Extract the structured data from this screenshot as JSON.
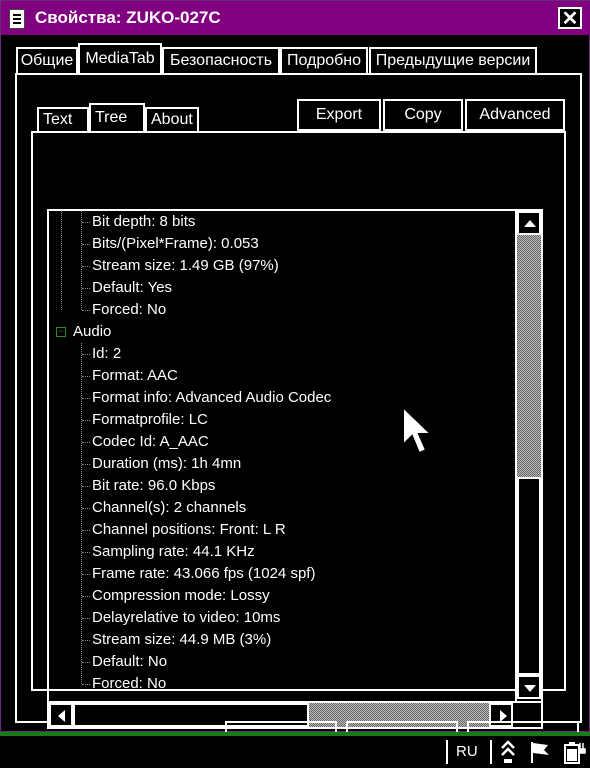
{
  "window": {
    "title": "Свойства: ZUKO-027C",
    "close_label": "✕"
  },
  "main_tabs": [
    {
      "label": "Общие",
      "active": false
    },
    {
      "label": "MediaTab",
      "active": true
    },
    {
      "label": "Безопасность",
      "active": false
    },
    {
      "label": "Подробно",
      "active": false
    },
    {
      "label": "Предыдущие версии",
      "active": false
    }
  ],
  "sub_tabs": [
    {
      "label": "Text",
      "active": false
    },
    {
      "label": "Tree",
      "active": true
    },
    {
      "label": "About",
      "active": false
    }
  ],
  "actions": {
    "export_label": "Export",
    "copy_label": "Copy",
    "advanced_label": "Advanced"
  },
  "tree": {
    "video_items": [
      "Bit depth: 8 bits",
      "Bits/(Pixel*Frame): 0.053",
      "Stream size: 1.49 GB (97%)",
      "Default: Yes",
      "Forced: No"
    ],
    "audio_node": {
      "label": "Audio",
      "toggle": "−",
      "items": [
        "Id: 2",
        "Format: AAC",
        "Format info: Advanced Audio Codec",
        "Formatprofile: LC",
        "Codec Id: A_AAC",
        "Duration (ms): 1h 4mn",
        "Bit rate: 96.0 Kbps",
        "Channel(s): 2 channels",
        "Channel positions: Front: L R",
        "Sampling rate: 44.1 KHz",
        "Frame rate: 43.066 fps (1024 spf)",
        "Compression mode: Lossy",
        "Delayrelative to video: 10ms",
        "Stream size: 44.9 MB (3%)",
        "Default: No",
        "Forced: No"
      ]
    }
  },
  "scrollbars": {
    "vertical_position": 1.0,
    "horizontal_position": 0.0
  },
  "taskbar": {
    "language": "RU",
    "tray_icons": [
      "keyboard-chevrons-icon",
      "flag-icon",
      "battery-plug-icon"
    ]
  },
  "colors": {
    "titlebar": "#800080",
    "taskbar_border": "#1a7a1a",
    "tree_toggle": "#2a8a2a"
  }
}
